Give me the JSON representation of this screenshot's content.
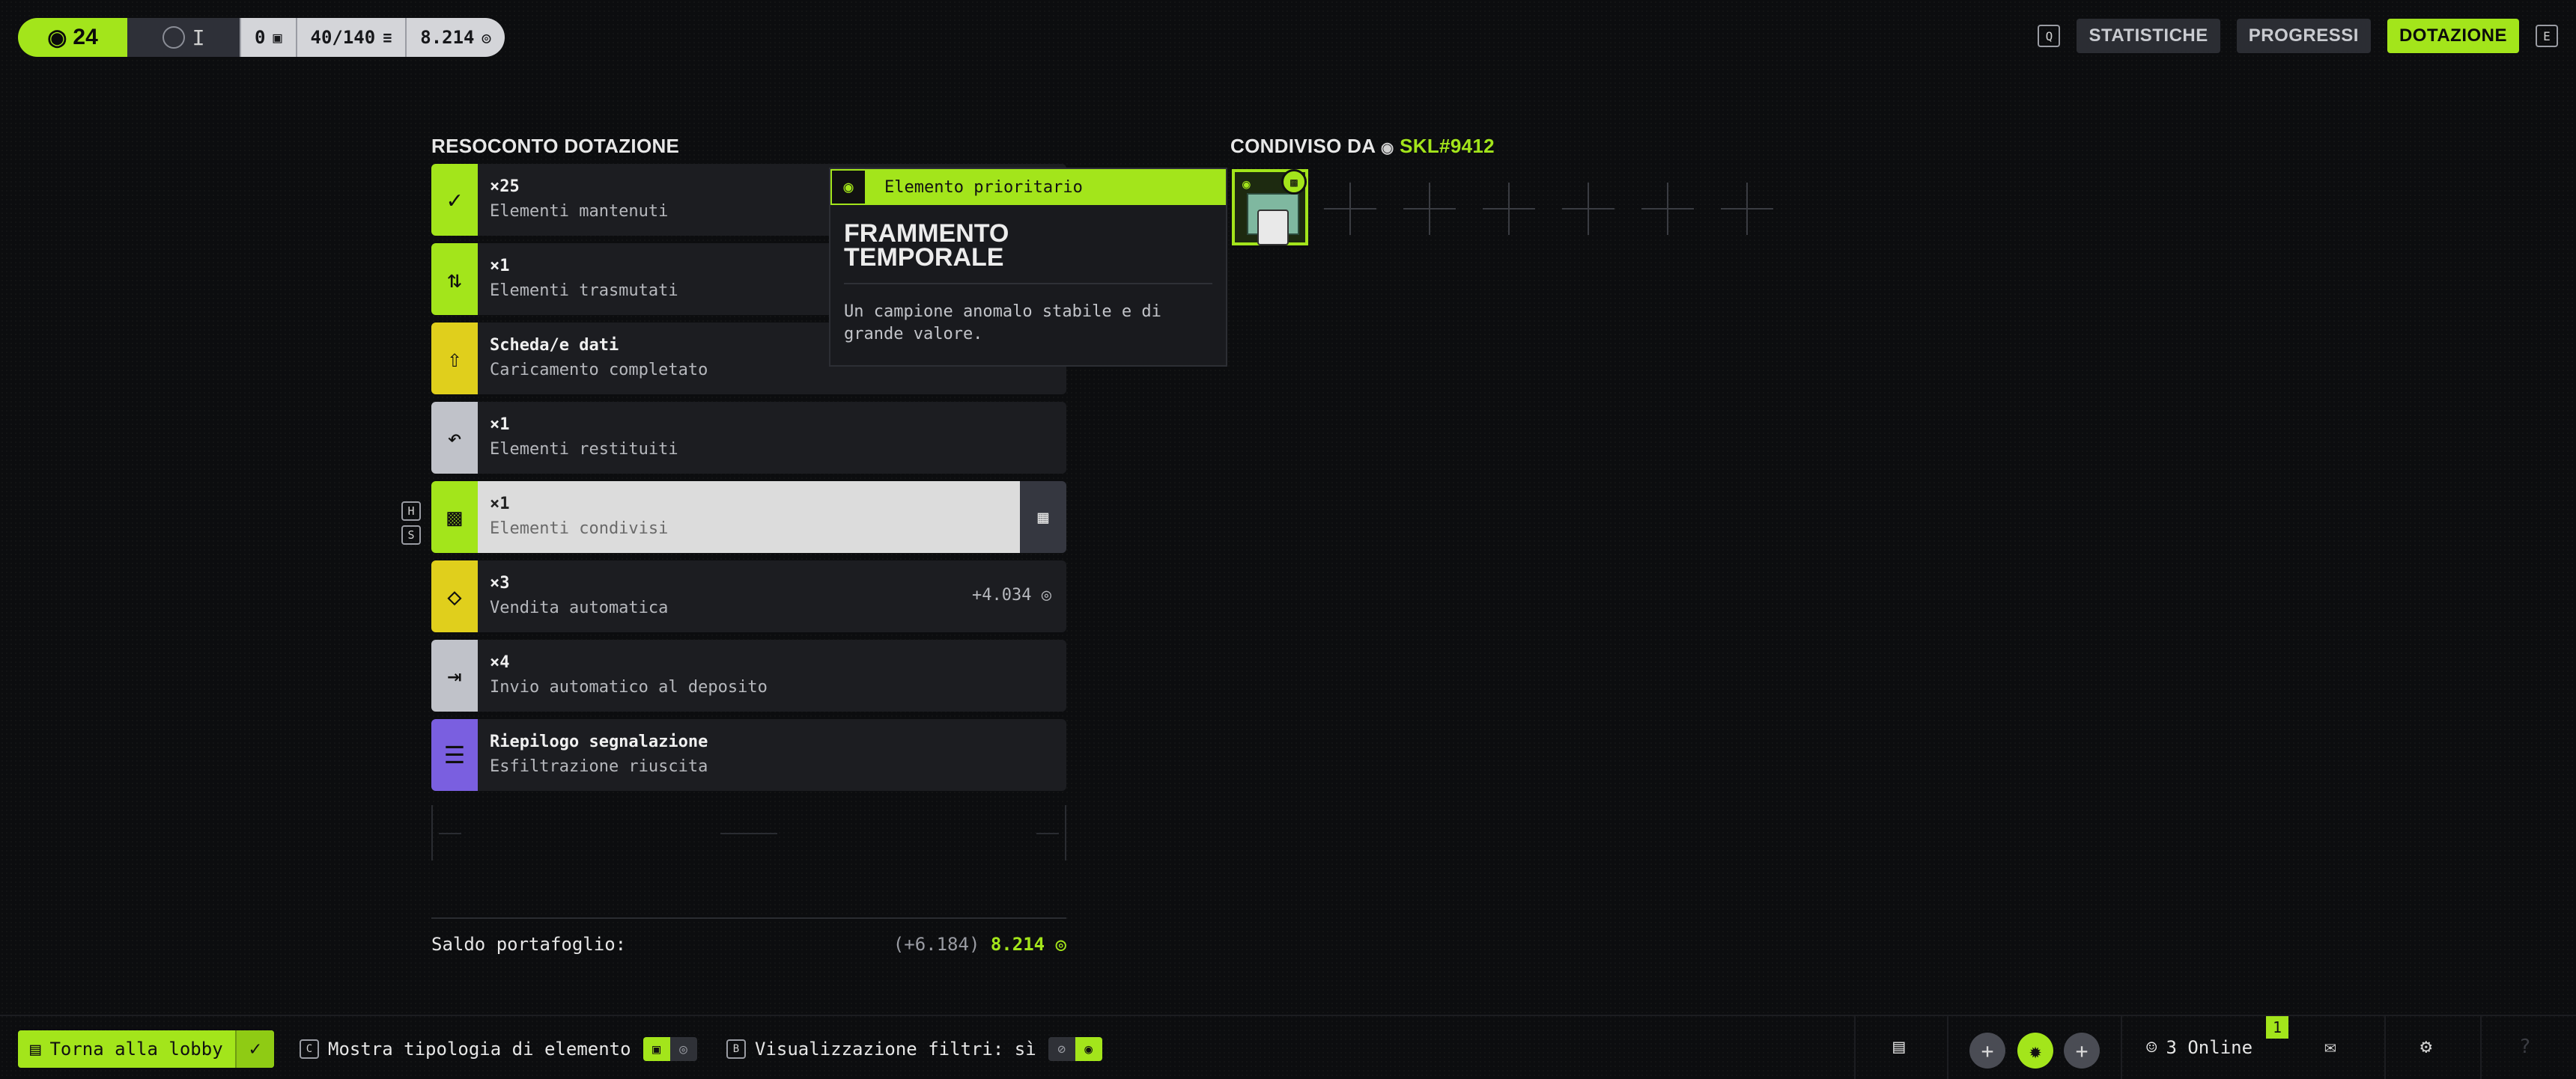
{
  "topbar": {
    "level": "24",
    "rank": "I",
    "counter_a": "0",
    "capacity": "40/140",
    "currency": "8.214",
    "key_left": "Q",
    "key_right": "E",
    "nav": [
      "STATISTICHE",
      "PROGRESSI",
      "DOTAZIONE"
    ],
    "active_nav": "DOTAZIONE"
  },
  "summary": {
    "title": "RESOCONTO DOTAZIONE",
    "rows": [
      {
        "l1": "×25",
        "l2": "Elementi mantenuti",
        "icon": "check-icon",
        "color": "#a3e51b",
        "value": ""
      },
      {
        "l1": "×1",
        "l2": "Elementi trasmutati",
        "icon": "transmute-icon",
        "color": "#a3e51b",
        "value": ""
      },
      {
        "l1": "Scheda/e dati",
        "l2": "Caricamento completato",
        "icon": "upload-icon",
        "color": "#e0cf1c",
        "value": ""
      },
      {
        "l1": "×1",
        "l2": "Elementi restituiti",
        "icon": "return-icon",
        "color": "#c0c2c9",
        "value": ""
      },
      {
        "l1": "×1",
        "l2": "Elementi condivisi",
        "icon": "share-icon",
        "color": "#a3e51b",
        "value": ""
      },
      {
        "l1": "×3",
        "l2": "Vendita automatica",
        "icon": "sell-icon",
        "color": "#e0cf1c",
        "value": "+4.034"
      },
      {
        "l1": "×4",
        "l2": "Invio automatico al deposito",
        "icon": "deposit-icon",
        "color": "#c0c2c9",
        "value": ""
      },
      {
        "l1": "Riepilogo segnalazione",
        "l2": "Esfiltrazione riuscita",
        "icon": "list-icon",
        "color": "#7a5fe0",
        "value": ""
      }
    ],
    "hs_keys": [
      "H",
      "S"
    ]
  },
  "wallet": {
    "label": "Saldo portafoglio:",
    "delta": "(+6.184)",
    "balance": "8.214"
  },
  "tooltip": {
    "tag": "Elemento prioritario",
    "title_line1": "FRAMMENTO",
    "title_line2": "TEMPORALE",
    "desc_line1": "Un campione anomalo stabile e di",
    "desc_line2": "grande valore."
  },
  "shared": {
    "prefix": "CONDIVISO DA",
    "user": "SKL#9412"
  },
  "bottombar": {
    "lobby_label": "Torna alla lobby",
    "opt1_key": "C",
    "opt1_label": "Mostra tipologia di elemento",
    "opt2_key": "B",
    "opt2_label": "Visualizzazione filtri: sì",
    "online": "3 Online",
    "notif_count": "1"
  }
}
